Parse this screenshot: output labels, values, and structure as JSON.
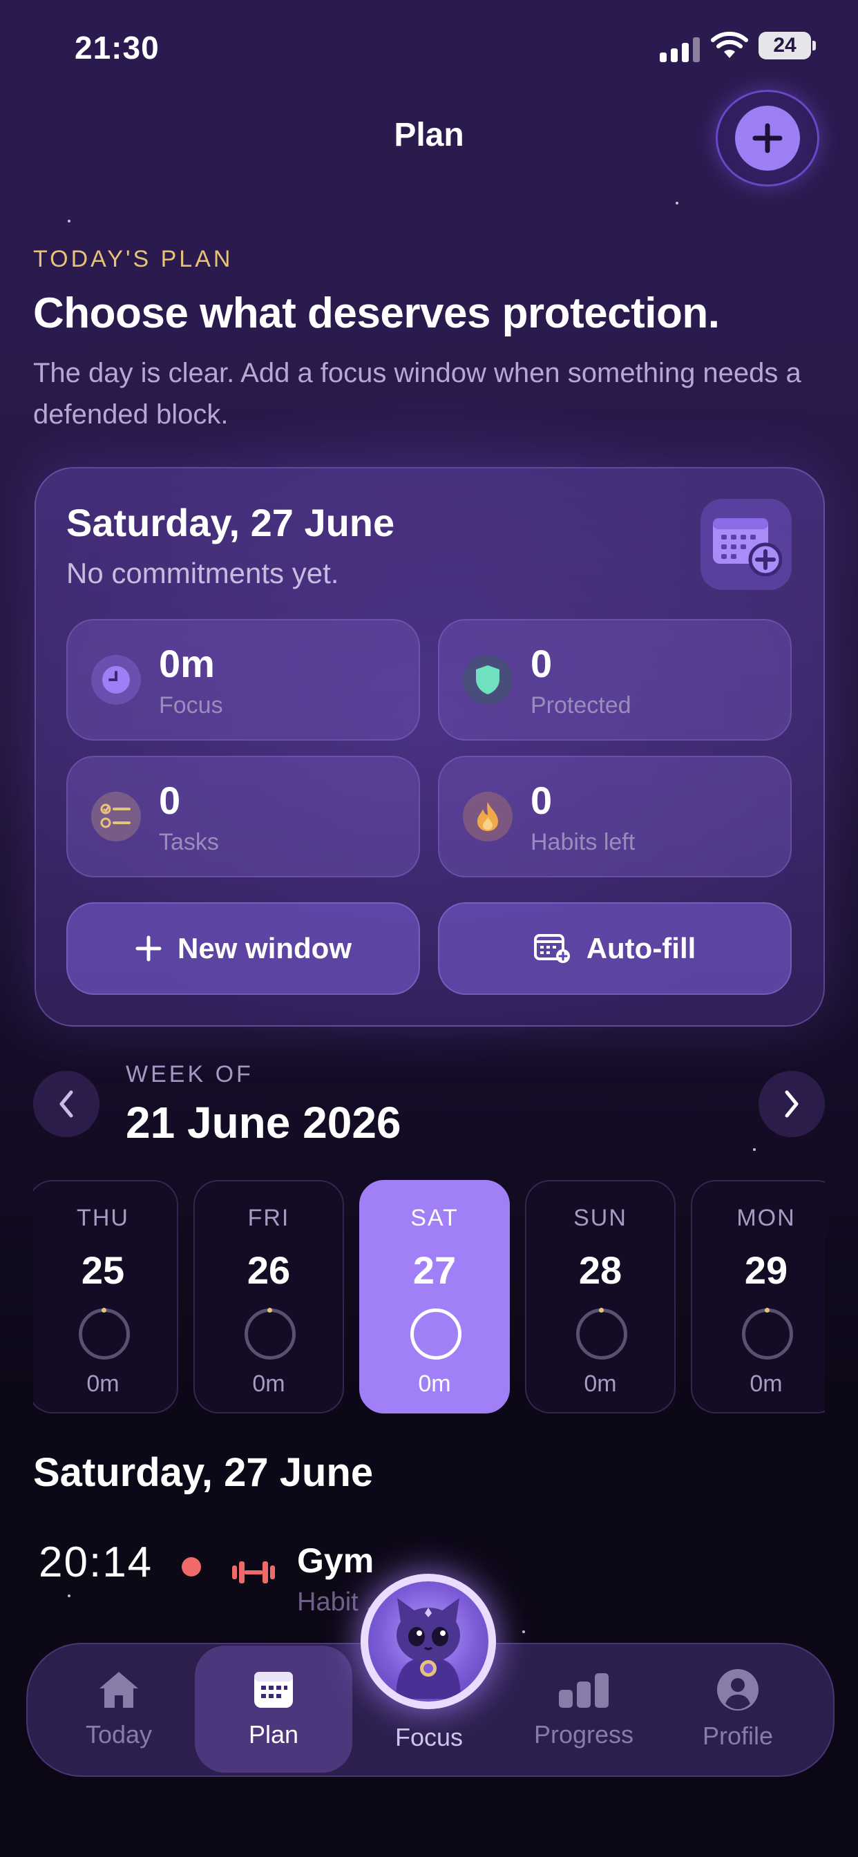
{
  "status_bar": {
    "time": "21:30",
    "battery": "24"
  },
  "header": {
    "title": "Plan"
  },
  "intro": {
    "eyebrow": "TODAY'S PLAN",
    "headline": "Choose what deserves protection.",
    "subtext": "The day is clear. Add a focus window when something needs a defended block."
  },
  "summary_card": {
    "date": "Saturday, 27 June",
    "subtitle": "No commitments yet.",
    "stats": [
      {
        "value": "0m",
        "label": "Focus",
        "icon": "clock-icon",
        "color": "#9f7ff5"
      },
      {
        "value": "0",
        "label": "Protected",
        "icon": "shield-icon",
        "color": "#6fe0c0"
      },
      {
        "value": "0",
        "label": "Tasks",
        "icon": "checklist-icon",
        "color": "#e8c27a"
      },
      {
        "value": "0",
        "label": "Habits left",
        "icon": "flame-icon",
        "color": "#f0a94a"
      }
    ],
    "actions": {
      "new_window": "New window",
      "auto_fill": "Auto-fill"
    }
  },
  "week": {
    "eyebrow": "WEEK OF",
    "label": "21 June 2026",
    "days": [
      {
        "name": "THU",
        "num": "25",
        "minutes": "0m",
        "selected": false
      },
      {
        "name": "FRI",
        "num": "26",
        "minutes": "0m",
        "selected": false
      },
      {
        "name": "SAT",
        "num": "27",
        "minutes": "0m",
        "selected": true
      },
      {
        "name": "SUN",
        "num": "28",
        "minutes": "0m",
        "selected": false
      },
      {
        "name": "MON",
        "num": "29",
        "minutes": "0m",
        "selected": false
      }
    ]
  },
  "agenda": {
    "date": "Saturday, 27 June",
    "events": [
      {
        "time": "20:14",
        "title": "Gym",
        "subtitle": "Habit ... d",
        "icon": "dumbbell-icon",
        "color": "#f06a6a"
      }
    ]
  },
  "tabbar": {
    "tabs": [
      {
        "label": "Today",
        "icon": "home-icon"
      },
      {
        "label": "Plan",
        "icon": "calendar-icon",
        "active": true
      },
      {
        "label": "Focus",
        "icon": "cat-mascot-icon"
      },
      {
        "label": "Progress",
        "icon": "bar-chart-icon"
      },
      {
        "label": "Profile",
        "icon": "person-icon"
      }
    ]
  }
}
